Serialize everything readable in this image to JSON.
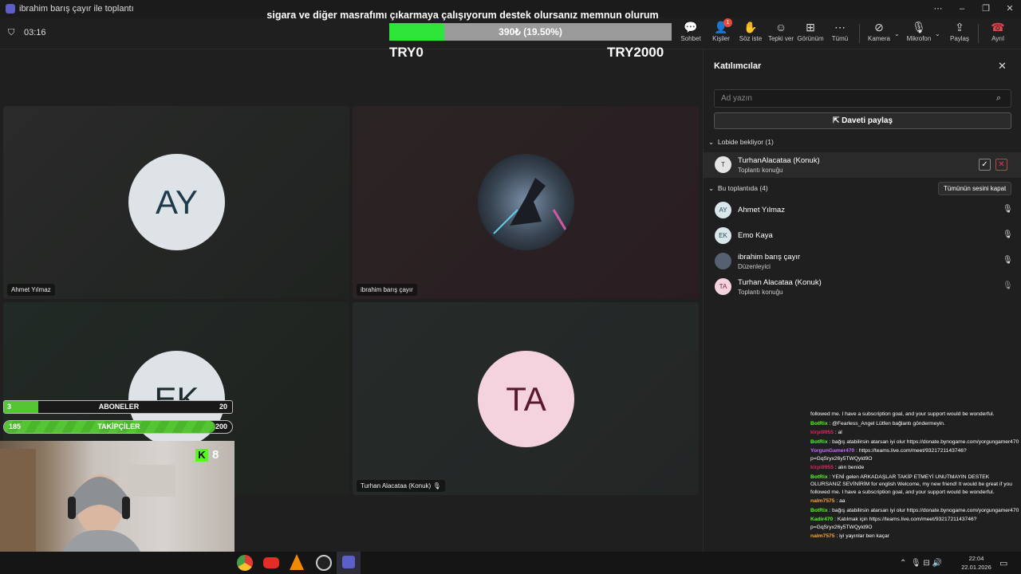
{
  "window": {
    "title": "ibrahim barış çayır ile toplantı",
    "controls": [
      "⋯",
      "–",
      "❐",
      "✕"
    ]
  },
  "toolbar": {
    "timer": "03:16",
    "buttons": [
      {
        "label": "Sohbet",
        "icon": "chat-icon"
      },
      {
        "label": "Kişiler",
        "icon": "people-icon",
        "badge": "1"
      },
      {
        "label": "Söz iste",
        "icon": "raise-hand-icon"
      },
      {
        "label": "Tepki ver",
        "icon": "react-icon"
      },
      {
        "label": "Görünüm",
        "icon": "view-icon"
      },
      {
        "label": "Tümü",
        "icon": "more-icon"
      },
      {
        "label": "Kamera",
        "icon": "camera-off-icon"
      },
      {
        "label": "Mikrofon",
        "icon": "mic-icon"
      },
      {
        "label": "Paylaş",
        "icon": "share-icon"
      },
      {
        "label": "Ayrıl",
        "icon": "leave-icon"
      }
    ]
  },
  "donation": {
    "title": "sigara ve diğer masrafımı çıkarmaya çalışıyorum destek olursanız memnun olurum",
    "progress_text": "390₺ (19.50%)",
    "progress_fraction": 0.195,
    "min_label": "TRY0",
    "max_label": "TRY2000"
  },
  "tiles": [
    {
      "initials": "AY",
      "name": "Ahmet Yılmaz",
      "bg": "#dde3e6",
      "fg": "#1f3a4a"
    },
    {
      "initials": "",
      "name": "ibrahim barış çayır",
      "bg": "#3a4a5a",
      "fg": "#fff"
    },
    {
      "initials": "EK",
      "name": "",
      "bg": "#dde3e6",
      "fg": "#1e2b2e"
    },
    {
      "initials": "TA",
      "name": "Turhan Alacataa (Konuk)",
      "bg": "#f4d3de",
      "fg": "#5a1830"
    }
  ],
  "stream": {
    "subs": {
      "current": "3",
      "label": "ABONELER",
      "goal": "20",
      "fraction": 0.15
    },
    "followers": {
      "current": "185",
      "label": "TAKİPÇİLER",
      "goal": "200",
      "fraction": 0.925
    },
    "kick_count": "8"
  },
  "panel": {
    "title": "Katılımcılar",
    "search_placeholder": "Ad yazın",
    "share_label": "Daveti paylaş",
    "lobby_header": "Lobide bekliyor (1)",
    "lobby": {
      "initial": "T",
      "name": "TurhanAlacataa (Konuk)",
      "role": "Toplantı konuğu"
    },
    "meeting_header": "Bu toplantıda (4)",
    "mute_all": "Tümünün sesini kapat",
    "participants": [
      {
        "initials": "AY",
        "name": "Ahmet Yılmaz",
        "role": "",
        "bg": "#d9e6ea",
        "fg": "#2a4a56",
        "muted": false
      },
      {
        "initials": "EK",
        "name": "Emo Kaya",
        "role": "",
        "bg": "#d9e6ea",
        "fg": "#2a4a56",
        "muted": false
      },
      {
        "initials": "",
        "name": "ibrahim barış çayır",
        "role": "Düzenleyici",
        "bg": "#556070",
        "fg": "#fff",
        "muted": false
      },
      {
        "initials": "TA",
        "name": "Turhan Alacataa (Konuk)",
        "role": "Toplantı konuğu",
        "bg": "#f4d3de",
        "fg": "#7a2040",
        "muted": true
      }
    ]
  },
  "chat": [
    {
      "user": "",
      "text": "followed me. I have a subscription goal, and your support would be wonderful.",
      "color": "#fff"
    },
    {
      "user": "BotRix",
      "text": ": @Fearless_Angel Lütfen bağlantı göndermeyin.",
      "color": "#53fc18"
    },
    {
      "user": "kirpi9955",
      "text": ": al",
      "color": "#e0245e"
    },
    {
      "user": "BotRix",
      "text": ": bağış atabilirsin atarsan iyi olur https://donate.bynogame.com/yorgungamer470",
      "color": "#53fc18"
    },
    {
      "user": "YorgunGamer470",
      "text": ": https://teams.live.com/meet/9321721143746?p=GqSryx26y5TWQyld9O",
      "color": "#c76bff"
    },
    {
      "user": "kirpi9955",
      "text": ": alın benide",
      "color": "#e0245e"
    },
    {
      "user": "BotRix",
      "text": ": YENİ gelen ARKADAŞLAR TAKİP ETMEYİ UNUTMAYIN DESTEK OLURSANIZ SEVİNİRİM for english Welcome, my new friend! It would be great if you followed me. I have a subscription goal, and your support would be wonderful.",
      "color": "#53fc18"
    },
    {
      "user": "nalm7575",
      "text": ": aa",
      "color": "#f5a623"
    },
    {
      "user": "BotRix",
      "text": ": bağış atabilirsin atarsan iyi olur https://donate.bynogame.com/yorgungamer470",
      "color": "#53fc18"
    },
    {
      "user": "Kadir470",
      "text": ": Katılmak için https://teams.live.com/meet/9321721143746?p=GqSryx26y5TWQyld9O",
      "color": "#53fc18"
    },
    {
      "user": "nalm7575",
      "text": ": iyi yayınlar ben kaçar",
      "color": "#f5a623"
    }
  ],
  "taskbar": {
    "time": "22:04",
    "date": "22.01.2026"
  }
}
